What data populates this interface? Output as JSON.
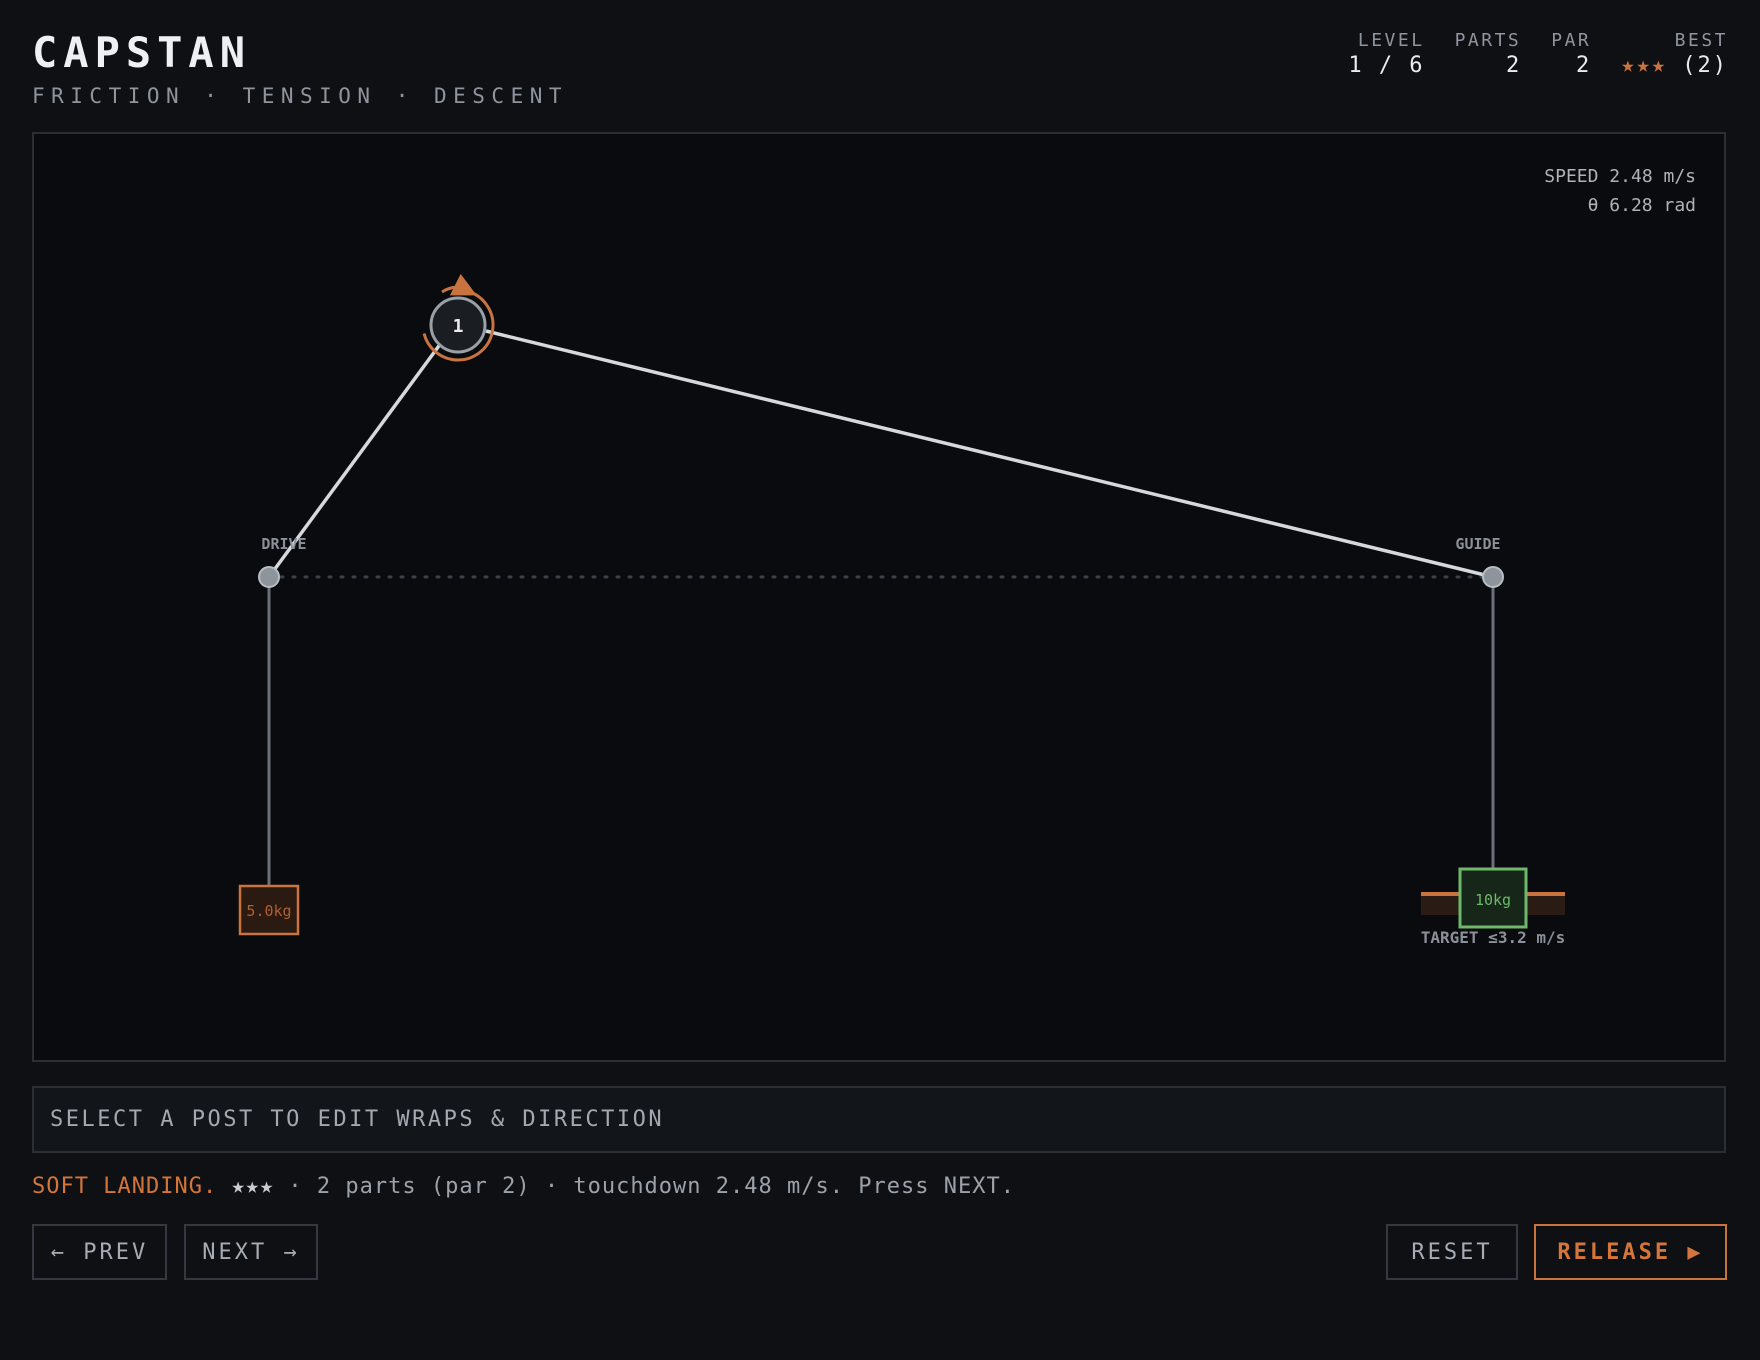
{
  "header": {
    "title": "CAPSTAN",
    "subtitle": "FRICTION · TENSION · DESCENT"
  },
  "stats": {
    "level_label": "LEVEL",
    "level_value": "1 / 6",
    "parts_label": "PARTS",
    "parts_value": "2",
    "par_label": "PAR",
    "par_value": "2",
    "best_label": "BEST",
    "best_stars": "★★★",
    "best_value": " (2)"
  },
  "readout": {
    "speed": "SPEED 2.48 m/s",
    "theta": "θ 6.28 rad"
  },
  "scene": {
    "drive_label": "DRIVE",
    "guide_label": "GUIDE",
    "capstan_number": "1",
    "counterweight_label": "5.0kg",
    "load_label": "10kg",
    "target_label": "TARGET ≤3.2 m/s",
    "accent_color": "#c9743f",
    "load_color": "#6db86a"
  },
  "hint": {
    "text": "SELECT A POST TO EDIT WRAPS & DIRECTION"
  },
  "status": {
    "headline": "SOFT LANDING.",
    "stars": "★★★",
    "detail": " · 2 parts (par 2) · touchdown 2.48 m/s. Press NEXT."
  },
  "buttons": {
    "prev": "← PREV",
    "next": "NEXT →",
    "reset": "RESET",
    "release": "RELEASE ▶"
  }
}
